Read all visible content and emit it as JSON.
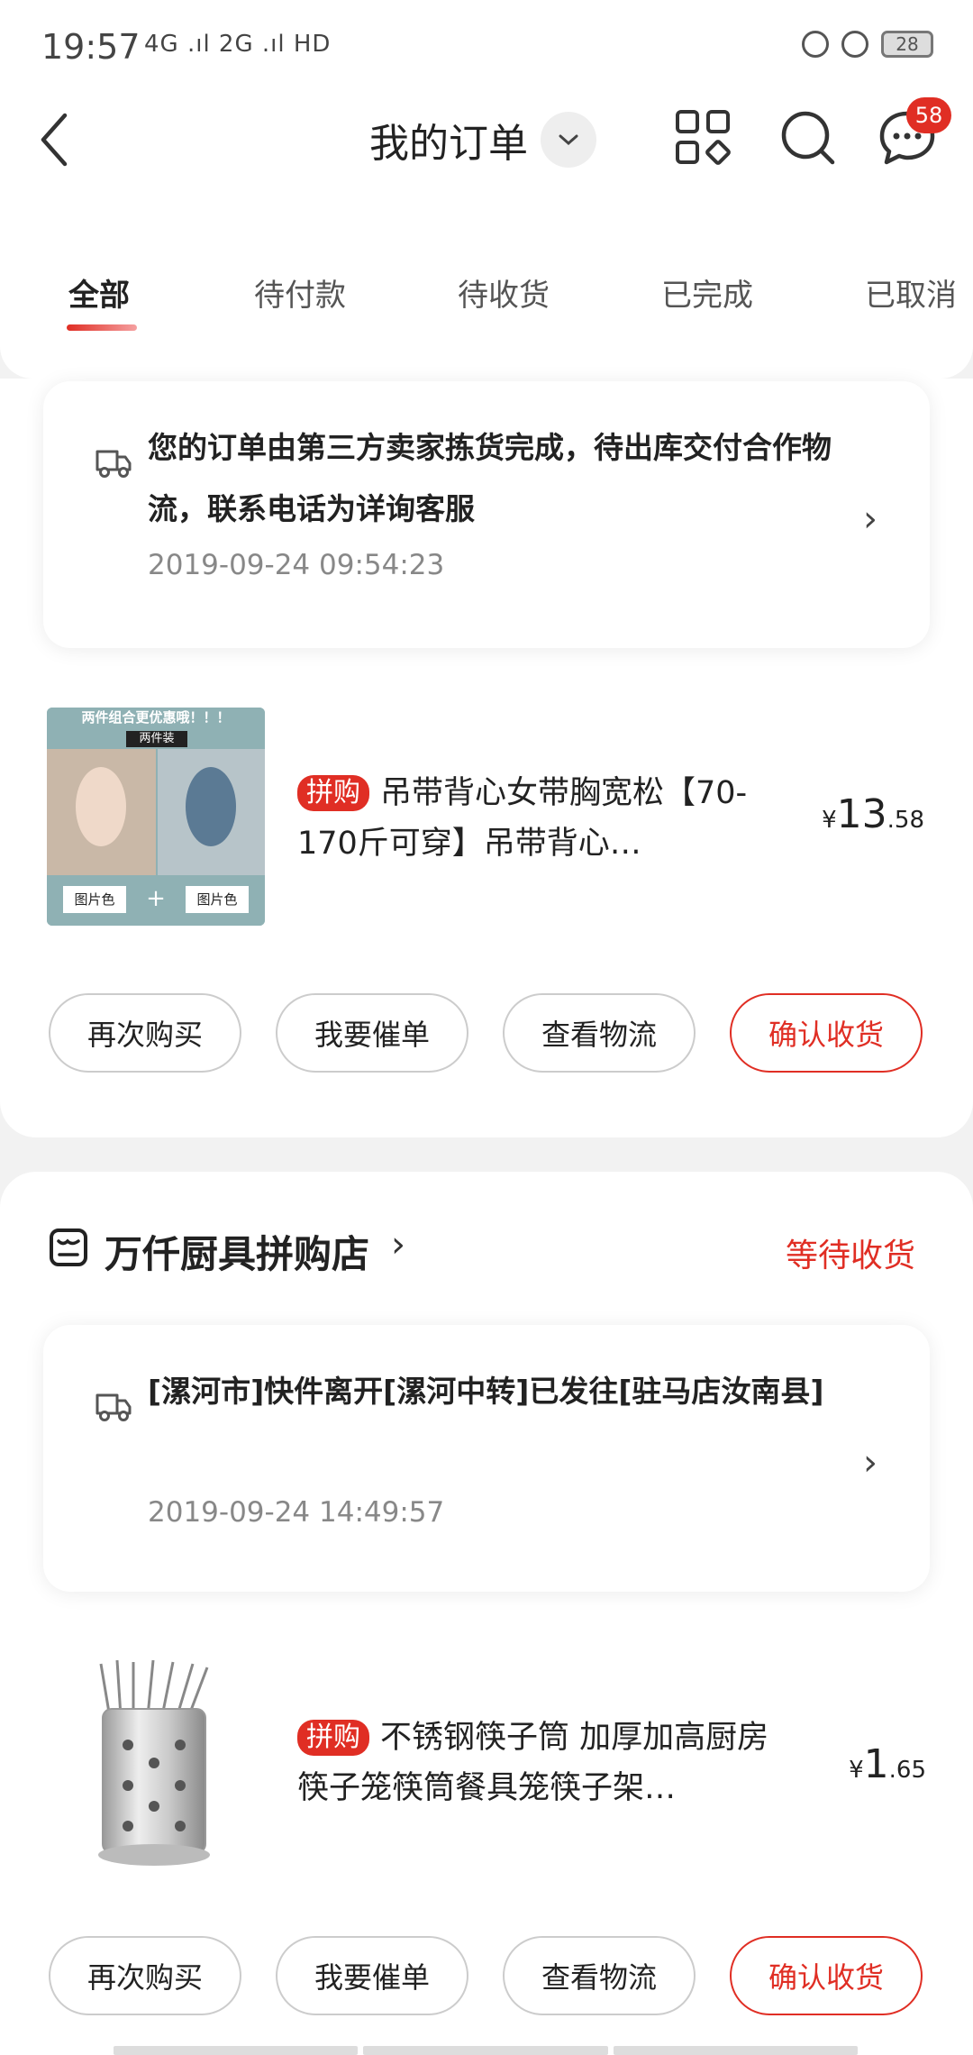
{
  "status_bar": {
    "time": "19:57",
    "signal": "4G .ıl 2G .ıl HD",
    "battery": "28"
  },
  "header": {
    "title": "我的订单",
    "message_badge": "58"
  },
  "tabs": [
    {
      "label": "全部",
      "active": true
    },
    {
      "label": "待付款",
      "active": false
    },
    {
      "label": "待收货",
      "active": false
    },
    {
      "label": "已完成",
      "active": false
    },
    {
      "label": "已取消",
      "active": false
    }
  ],
  "orders": [
    {
      "logistics": {
        "text": "您的订单由第三方卖家拣货完成，待出库交付合作物流，联系电话为详询客服",
        "time": "2019-09-24 09:54:23"
      },
      "product": {
        "tag": "拼购",
        "title": "吊带背心女带胸宽松【70-170斤可穿】吊带背心…",
        "price_symbol": "¥",
        "price_int": "13",
        "price_dec": ".58",
        "thumb_banner": "两件组合更优惠哦！！！",
        "thumb_sub": "两件装",
        "thumb_label_left": "图片色",
        "thumb_plus": "+",
        "thumb_label_right": "图片色"
      },
      "buttons": [
        "再次购买",
        "我要催单",
        "查看物流",
        "确认收货"
      ]
    },
    {
      "shop": "万仟厨具拼购店",
      "status": "等待收货",
      "logistics": {
        "text": "[漯河市]快件离开[漯河中转]已发往[驻马店汝南县]",
        "time": "2019-09-24 14:49:57"
      },
      "product": {
        "tag": "拼购",
        "title": "不锈钢筷子筒 加厚加高厨房筷子笼筷筒餐具笼筷子架…",
        "price_symbol": "¥",
        "price_int": "1",
        "price_dec": ".65"
      },
      "buttons": [
        "再次购买",
        "我要催单",
        "查看物流",
        "确认收货"
      ]
    }
  ],
  "colors": {
    "accent": "#e02e24",
    "background": "#f2f2f2"
  }
}
